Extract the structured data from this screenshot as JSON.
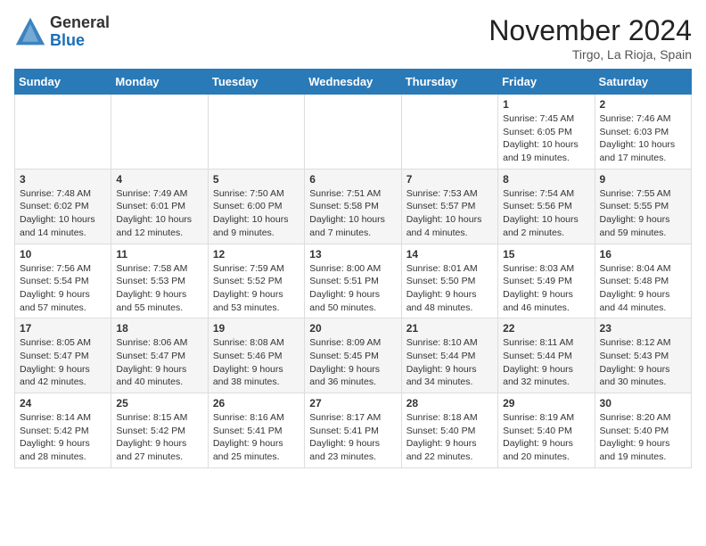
{
  "header": {
    "logo_general": "General",
    "logo_blue": "Blue",
    "month_title": "November 2024",
    "location": "Tirgo, La Rioja, Spain"
  },
  "days_of_week": [
    "Sunday",
    "Monday",
    "Tuesday",
    "Wednesday",
    "Thursday",
    "Friday",
    "Saturday"
  ],
  "weeks": [
    [
      {
        "day": "",
        "info": ""
      },
      {
        "day": "",
        "info": ""
      },
      {
        "day": "",
        "info": ""
      },
      {
        "day": "",
        "info": ""
      },
      {
        "day": "",
        "info": ""
      },
      {
        "day": "1",
        "info": "Sunrise: 7:45 AM\nSunset: 6:05 PM\nDaylight: 10 hours and 19 minutes."
      },
      {
        "day": "2",
        "info": "Sunrise: 7:46 AM\nSunset: 6:03 PM\nDaylight: 10 hours and 17 minutes."
      }
    ],
    [
      {
        "day": "3",
        "info": "Sunrise: 7:48 AM\nSunset: 6:02 PM\nDaylight: 10 hours and 14 minutes."
      },
      {
        "day": "4",
        "info": "Sunrise: 7:49 AM\nSunset: 6:01 PM\nDaylight: 10 hours and 12 minutes."
      },
      {
        "day": "5",
        "info": "Sunrise: 7:50 AM\nSunset: 6:00 PM\nDaylight: 10 hours and 9 minutes."
      },
      {
        "day": "6",
        "info": "Sunrise: 7:51 AM\nSunset: 5:58 PM\nDaylight: 10 hours and 7 minutes."
      },
      {
        "day": "7",
        "info": "Sunrise: 7:53 AM\nSunset: 5:57 PM\nDaylight: 10 hours and 4 minutes."
      },
      {
        "day": "8",
        "info": "Sunrise: 7:54 AM\nSunset: 5:56 PM\nDaylight: 10 hours and 2 minutes."
      },
      {
        "day": "9",
        "info": "Sunrise: 7:55 AM\nSunset: 5:55 PM\nDaylight: 9 hours and 59 minutes."
      }
    ],
    [
      {
        "day": "10",
        "info": "Sunrise: 7:56 AM\nSunset: 5:54 PM\nDaylight: 9 hours and 57 minutes."
      },
      {
        "day": "11",
        "info": "Sunrise: 7:58 AM\nSunset: 5:53 PM\nDaylight: 9 hours and 55 minutes."
      },
      {
        "day": "12",
        "info": "Sunrise: 7:59 AM\nSunset: 5:52 PM\nDaylight: 9 hours and 53 minutes."
      },
      {
        "day": "13",
        "info": "Sunrise: 8:00 AM\nSunset: 5:51 PM\nDaylight: 9 hours and 50 minutes."
      },
      {
        "day": "14",
        "info": "Sunrise: 8:01 AM\nSunset: 5:50 PM\nDaylight: 9 hours and 48 minutes."
      },
      {
        "day": "15",
        "info": "Sunrise: 8:03 AM\nSunset: 5:49 PM\nDaylight: 9 hours and 46 minutes."
      },
      {
        "day": "16",
        "info": "Sunrise: 8:04 AM\nSunset: 5:48 PM\nDaylight: 9 hours and 44 minutes."
      }
    ],
    [
      {
        "day": "17",
        "info": "Sunrise: 8:05 AM\nSunset: 5:47 PM\nDaylight: 9 hours and 42 minutes."
      },
      {
        "day": "18",
        "info": "Sunrise: 8:06 AM\nSunset: 5:47 PM\nDaylight: 9 hours and 40 minutes."
      },
      {
        "day": "19",
        "info": "Sunrise: 8:08 AM\nSunset: 5:46 PM\nDaylight: 9 hours and 38 minutes."
      },
      {
        "day": "20",
        "info": "Sunrise: 8:09 AM\nSunset: 5:45 PM\nDaylight: 9 hours and 36 minutes."
      },
      {
        "day": "21",
        "info": "Sunrise: 8:10 AM\nSunset: 5:44 PM\nDaylight: 9 hours and 34 minutes."
      },
      {
        "day": "22",
        "info": "Sunrise: 8:11 AM\nSunset: 5:44 PM\nDaylight: 9 hours and 32 minutes."
      },
      {
        "day": "23",
        "info": "Sunrise: 8:12 AM\nSunset: 5:43 PM\nDaylight: 9 hours and 30 minutes."
      }
    ],
    [
      {
        "day": "24",
        "info": "Sunrise: 8:14 AM\nSunset: 5:42 PM\nDaylight: 9 hours and 28 minutes."
      },
      {
        "day": "25",
        "info": "Sunrise: 8:15 AM\nSunset: 5:42 PM\nDaylight: 9 hours and 27 minutes."
      },
      {
        "day": "26",
        "info": "Sunrise: 8:16 AM\nSunset: 5:41 PM\nDaylight: 9 hours and 25 minutes."
      },
      {
        "day": "27",
        "info": "Sunrise: 8:17 AM\nSunset: 5:41 PM\nDaylight: 9 hours and 23 minutes."
      },
      {
        "day": "28",
        "info": "Sunrise: 8:18 AM\nSunset: 5:40 PM\nDaylight: 9 hours and 22 minutes."
      },
      {
        "day": "29",
        "info": "Sunrise: 8:19 AM\nSunset: 5:40 PM\nDaylight: 9 hours and 20 minutes."
      },
      {
        "day": "30",
        "info": "Sunrise: 8:20 AM\nSunset: 5:40 PM\nDaylight: 9 hours and 19 minutes."
      }
    ]
  ]
}
